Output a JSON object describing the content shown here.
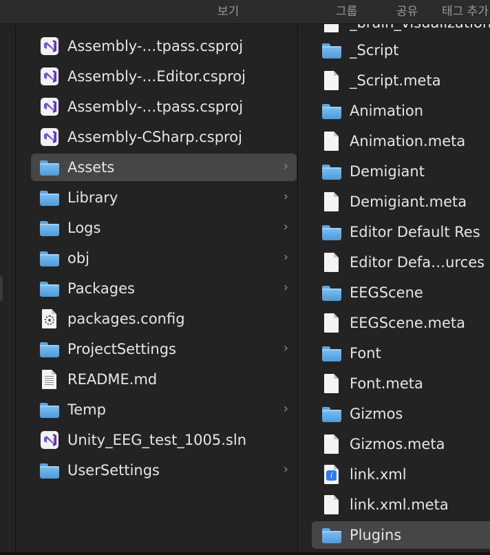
{
  "toolbar": {
    "view": "보기",
    "group": "그룹",
    "share": "공유",
    "tags": "태그 추가"
  },
  "column1": {
    "items": [
      {
        "label": "Assembly-…tpass.csproj",
        "icon": "vs-icon",
        "folder": false,
        "selected": false
      },
      {
        "label": "Assembly-…Editor.csproj",
        "icon": "vs-icon",
        "folder": false,
        "selected": false
      },
      {
        "label": "Assembly-…tpass.csproj",
        "icon": "vs-icon",
        "folder": false,
        "selected": false
      },
      {
        "label": "Assembly-CSharp.csproj",
        "icon": "vs-icon",
        "folder": false,
        "selected": false
      },
      {
        "label": "Assets",
        "icon": "folder-icon",
        "folder": true,
        "selected": true
      },
      {
        "label": "Library",
        "icon": "folder-icon",
        "folder": true,
        "selected": false
      },
      {
        "label": "Logs",
        "icon": "folder-icon",
        "folder": true,
        "selected": false
      },
      {
        "label": "obj",
        "icon": "folder-icon",
        "folder": true,
        "selected": false
      },
      {
        "label": "Packages",
        "icon": "folder-icon",
        "folder": true,
        "selected": false
      },
      {
        "label": "packages.config",
        "icon": "gear-doc-icon",
        "folder": false,
        "selected": false
      },
      {
        "label": "ProjectSettings",
        "icon": "folder-icon",
        "folder": true,
        "selected": false
      },
      {
        "label": "README.md",
        "icon": "text-doc-icon",
        "folder": false,
        "selected": false
      },
      {
        "label": "Temp",
        "icon": "folder-icon",
        "folder": true,
        "selected": false
      },
      {
        "label": "Unity_EEG_test_1005.sln",
        "icon": "vs-icon",
        "folder": false,
        "selected": false
      },
      {
        "label": "UserSettings",
        "icon": "folder-icon",
        "folder": true,
        "selected": false
      }
    ],
    "chevron": "›"
  },
  "column2": {
    "partial_top_item": "_brain_visualization",
    "items": [
      {
        "label": "_Script",
        "icon": "folder-icon",
        "selected": false
      },
      {
        "label": "_Script.meta",
        "icon": "doc-icon",
        "selected": false
      },
      {
        "label": "Animation",
        "icon": "folder-icon",
        "selected": false
      },
      {
        "label": "Animation.meta",
        "icon": "doc-icon",
        "selected": false
      },
      {
        "label": "Demigiant",
        "icon": "folder-icon",
        "selected": false
      },
      {
        "label": "Demigiant.meta",
        "icon": "doc-icon",
        "selected": false
      },
      {
        "label": "Editor Default Res",
        "icon": "folder-icon",
        "selected": false
      },
      {
        "label": "Editor Defa…urces",
        "icon": "doc-icon",
        "selected": false
      },
      {
        "label": "EEGScene",
        "icon": "folder-icon",
        "selected": false
      },
      {
        "label": "EEGScene.meta",
        "icon": "doc-icon",
        "selected": false
      },
      {
        "label": "Font",
        "icon": "folder-icon",
        "selected": false
      },
      {
        "label": "Font.meta",
        "icon": "doc-icon",
        "selected": false
      },
      {
        "label": "Gizmos",
        "icon": "folder-icon",
        "selected": false
      },
      {
        "label": "Gizmos.meta",
        "icon": "doc-icon",
        "selected": false
      },
      {
        "label": "link.xml",
        "icon": "xml-doc-icon",
        "selected": false
      },
      {
        "label": "link.xml.meta",
        "icon": "doc-icon",
        "selected": false
      },
      {
        "label": "Plugins",
        "icon": "folder-icon",
        "selected": true
      }
    ]
  },
  "colors": {
    "background": "#1e1e1e",
    "pane": "#232323",
    "selection": "#464646",
    "folder": "#5aa6e0",
    "vs_purple": "#7d4fd4"
  }
}
